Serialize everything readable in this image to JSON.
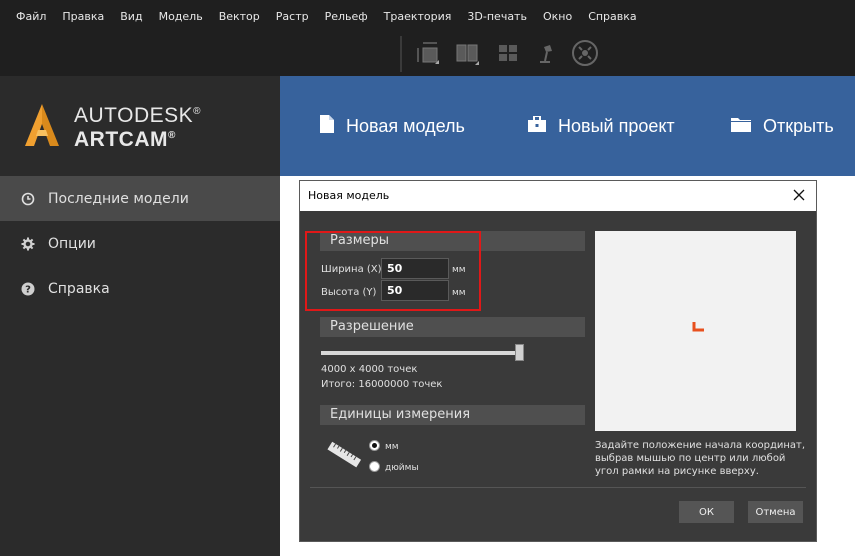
{
  "menu": [
    "Файл",
    "Правка",
    "Вид",
    "Модель",
    "Вектор",
    "Растр",
    "Рельеф",
    "Траектория",
    "3D-печать",
    "Окно",
    "Справка"
  ],
  "toolbar": {
    "icons": [
      "model-size-icon",
      "split-view-icon",
      "tile-view-icon",
      "lamp-icon",
      "orbit-icon"
    ]
  },
  "logo": {
    "line1": "AUTODESK",
    "line2": "ARTCAM",
    "reg": "®"
  },
  "nav": [
    {
      "label": "Последние модели",
      "icon": "clock-icon",
      "active": true
    },
    {
      "label": "Опции",
      "icon": "gear-icon",
      "active": false
    },
    {
      "label": "Справка",
      "icon": "help-icon",
      "active": false
    }
  ],
  "header": {
    "new_model": "Новая модель",
    "new_project": "Новый проект",
    "open": "Открыть"
  },
  "dialog": {
    "title": "Новая модель",
    "size_section": "Размеры",
    "width_label": "Ширина (X)",
    "width_value": "50",
    "height_label": "Высота (Y)",
    "height_value": "50",
    "unit_mm": "мм",
    "resolution_section": "Разрешение",
    "resolution_slider_fraction": 1.0,
    "resolution_points": "4000 x 4000 точек",
    "resolution_total": "Итого: 16000000 точек",
    "units_section": "Единицы измерения",
    "radio_mm": "мм",
    "radio_inches": "дюймы",
    "selected_unit": "мм",
    "hint": "Задайте положение начала координат, выбрав мышью по центр или любой угол рамки на рисунке вверху.",
    "ok": "ОК",
    "cancel": "Отмена"
  },
  "colors": {
    "header_blue": "#37629c",
    "highlight_red": "#e01818",
    "origin_orange": "#e8501e",
    "logo_orange": "#f0a030"
  }
}
